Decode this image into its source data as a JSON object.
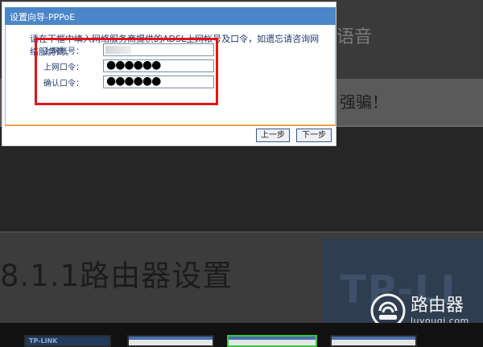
{
  "dialog": {
    "title": "设置向导-PPPoE",
    "description": "请在下框中填入网络服务商提供的ADSL上网帐号及口令，如遗忘请咨询网络服务商。",
    "fields": {
      "account_label": "上网账号：",
      "account_value": "",
      "password_label": "上网口令：",
      "password_value": "●●●●●●",
      "confirm_label": "确认口令：",
      "confirm_value": "●●●●●●"
    },
    "buttons": {
      "prev": "上一步",
      "next": "下一步"
    }
  },
  "background": {
    "heading_fragment": "语音",
    "warning_fragment": "强骗！",
    "big_title": "8.1.1路由器设置",
    "tplink_text": "TP-LI"
  },
  "thumbnails": {
    "first_label": "TP-LINK"
  },
  "watermark": {
    "name": "路由器",
    "domain": "luyouqi.com"
  },
  "colors": {
    "title_bar": "#4a86c8",
    "highlight_box": "#e0141c",
    "footer_line": "#f0a04b",
    "active_thumb": "#3ec43e"
  }
}
